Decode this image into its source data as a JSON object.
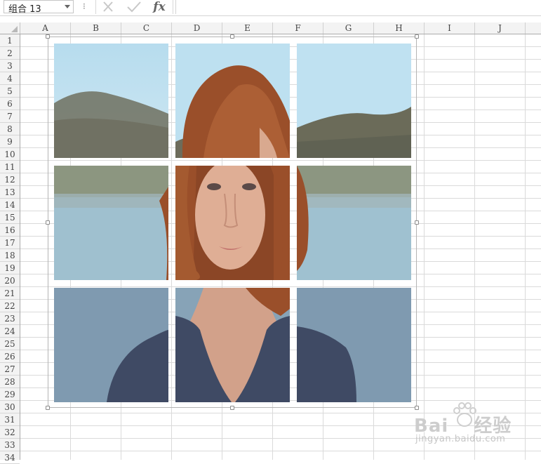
{
  "formula_bar": {
    "name_box_value": "组合 13",
    "menu_dots": "⁝",
    "fx_label": "fx",
    "formula_value": ""
  },
  "columns": [
    "A",
    "B",
    "C",
    "D",
    "E",
    "F",
    "G",
    "H",
    "I",
    "J"
  ],
  "rows": [
    "1",
    "2",
    "3",
    "4",
    "5",
    "6",
    "7",
    "8",
    "9",
    "10",
    "11",
    "12",
    "13",
    "14",
    "15",
    "16",
    "17",
    "18",
    "19",
    "20",
    "21",
    "22",
    "23",
    "24",
    "25",
    "26",
    "27",
    "28",
    "29",
    "30",
    "31",
    "32",
    "33",
    "34"
  ],
  "picture_group": {
    "tiles": [
      "photo-tile-top-left",
      "photo-tile-top-center",
      "photo-tile-top-right",
      "photo-tile-middle-left",
      "photo-tile-middle-center",
      "photo-tile-middle-right",
      "photo-tile-bottom-left",
      "photo-tile-bottom-center",
      "photo-tile-bottom-right"
    ],
    "handles": [
      "top-left",
      "top-center",
      "top-right",
      "middle-left",
      "middle-right",
      "bottom-left",
      "bottom-center",
      "bottom-right"
    ]
  },
  "watermark": {
    "logo_text": "Bai",
    "logo_cn": "经验",
    "sub_text": "jingyan.baidu.com"
  },
  "colors": {
    "grid_line": "#dadada",
    "header_bg": "#f3f3f3",
    "selection_handle": "#8c8c8c",
    "sky": "#bfe0f0",
    "hair": "#9a4f2a",
    "skin": "#d8a88f",
    "shirt": "#3f4a64"
  }
}
